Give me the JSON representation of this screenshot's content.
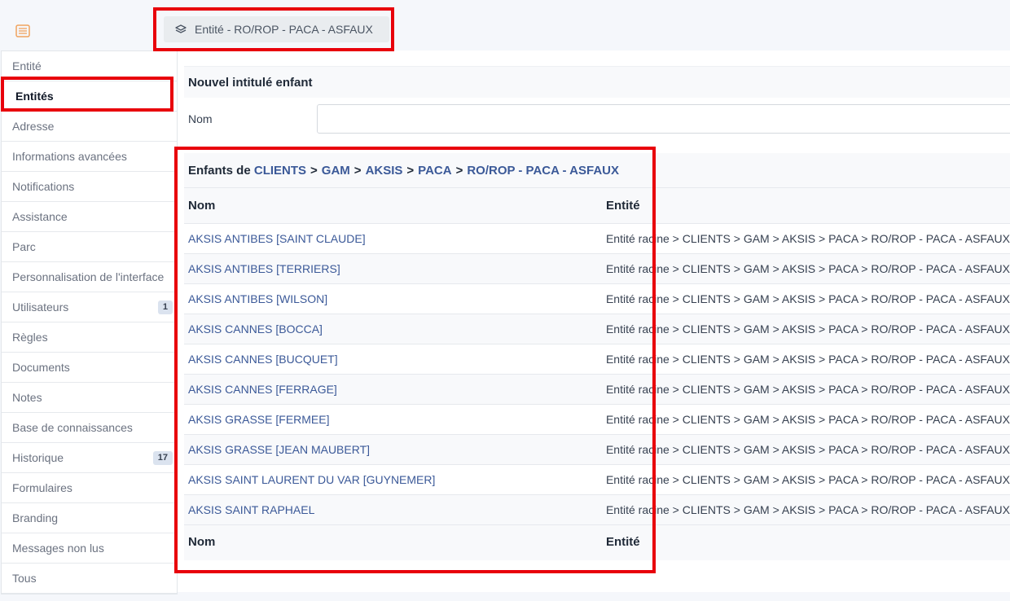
{
  "header": {
    "entity_badge": "Entité - RO/ROP - PACA - ASFAUX"
  },
  "sidebar": {
    "items": [
      {
        "label": "Entité",
        "badge": ""
      },
      {
        "label": "Entités",
        "badge": ""
      },
      {
        "label": "Adresse",
        "badge": ""
      },
      {
        "label": "Informations avancées",
        "badge": ""
      },
      {
        "label": "Notifications",
        "badge": ""
      },
      {
        "label": "Assistance",
        "badge": ""
      },
      {
        "label": "Parc",
        "badge": ""
      },
      {
        "label": "Personnalisation de l'interface",
        "badge": ""
      },
      {
        "label": "Utilisateurs",
        "badge": "1"
      },
      {
        "label": "Règles",
        "badge": ""
      },
      {
        "label": "Documents",
        "badge": ""
      },
      {
        "label": "Notes",
        "badge": ""
      },
      {
        "label": "Base de connaissances",
        "badge": ""
      },
      {
        "label": "Historique",
        "badge": "17"
      },
      {
        "label": "Formulaires",
        "badge": ""
      },
      {
        "label": "Branding",
        "badge": ""
      },
      {
        "label": "Messages non lus",
        "badge": ""
      },
      {
        "label": "Tous",
        "badge": ""
      }
    ]
  },
  "new_child": {
    "title": "Nouvel intitulé enfant",
    "name_label": "Nom",
    "name_value": ""
  },
  "children": {
    "title_prefix": "Enfants de",
    "path": [
      "CLIENTS",
      "GAM",
      "AKSIS",
      "PACA",
      "RO/ROP - PACA - ASFAUX"
    ],
    "path_sep": ">",
    "col_name": "Nom",
    "col_entity": "Entité",
    "rows": [
      {
        "name": "AKSIS ANTIBES [SAINT CLAUDE]",
        "entity": "Entité racine > CLIENTS > GAM > AKSIS > PACA > RO/ROP - PACA - ASFAUX"
      },
      {
        "name": "AKSIS ANTIBES [TERRIERS]",
        "entity": "Entité racine > CLIENTS > GAM > AKSIS > PACA > RO/ROP - PACA - ASFAUX"
      },
      {
        "name": "AKSIS ANTIBES [WILSON]",
        "entity": "Entité racine > CLIENTS > GAM > AKSIS > PACA > RO/ROP - PACA - ASFAUX"
      },
      {
        "name": "AKSIS CANNES [BOCCA]",
        "entity": "Entité racine > CLIENTS > GAM > AKSIS > PACA > RO/ROP - PACA - ASFAUX"
      },
      {
        "name": "AKSIS CANNES [BUCQUET]",
        "entity": "Entité racine > CLIENTS > GAM > AKSIS > PACA > RO/ROP - PACA - ASFAUX"
      },
      {
        "name": "AKSIS CANNES [FERRAGE]",
        "entity": "Entité racine > CLIENTS > GAM > AKSIS > PACA > RO/ROP - PACA - ASFAUX"
      },
      {
        "name": "AKSIS GRASSE [FERMEE]",
        "entity": "Entité racine > CLIENTS > GAM > AKSIS > PACA > RO/ROP - PACA - ASFAUX"
      },
      {
        "name": "AKSIS GRASSE [JEAN MAUBERT]",
        "entity": "Entité racine > CLIENTS > GAM > AKSIS > PACA > RO/ROP - PACA - ASFAUX"
      },
      {
        "name": "AKSIS SAINT LAURENT DU VAR [GUYNEMER]",
        "entity": "Entité racine > CLIENTS > GAM > AKSIS > PACA > RO/ROP - PACA - ASFAUX"
      },
      {
        "name": "AKSIS SAINT RAPHAEL",
        "entity": "Entité racine > CLIENTS > GAM > AKSIS > PACA > RO/ROP - PACA - ASFAUX"
      }
    ]
  },
  "colors": {
    "highlight": "#e8000b",
    "link": "#3b5998",
    "icon_orange": "#f0a35e"
  }
}
